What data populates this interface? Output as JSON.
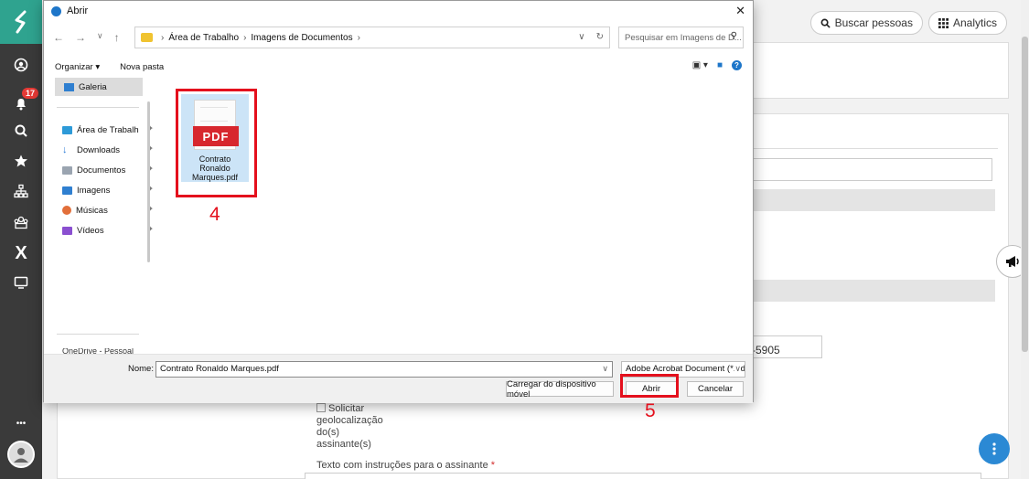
{
  "rail": {
    "logo": "๑",
    "notification_count": "17",
    "icons": [
      "user-circle-icon",
      "bell-icon",
      "search-icon",
      "star-icon",
      "org-chart-icon",
      "team-icon",
      "x-icon",
      "monitor-icon",
      "more-icon"
    ],
    "more_label": "•••"
  },
  "app": {
    "search_people_label": "Buscar pessoas",
    "analytics_label": "Analytics",
    "field_suffix": "-5905",
    "checkbox_label_lines": [
      "Solicitar",
      "geolocalização",
      "do(s)",
      "assinante(s)"
    ],
    "instructions_label": "Texto com instruções para o assinante",
    "required_mark": "*"
  },
  "dialog": {
    "title": "Abrir",
    "close": "✕",
    "breadcrumb": [
      "Área de Trabalho",
      "Imagens de Documentos"
    ],
    "search_placeholder": "Pesquisar em Imagens de D...",
    "organize_label": "Organizar ▾",
    "new_folder_label": "Nova pasta",
    "nav": {
      "gallery": "Galeria",
      "items": [
        {
          "label": "Área de Trabalh",
          "icon": "desktop-icon",
          "color": "#2d9ad8"
        },
        {
          "label": "Downloads",
          "icon": "download-icon",
          "color": "#2b7bd6"
        },
        {
          "label": "Documentos",
          "icon": "document-icon",
          "color": "#9aa4b0"
        },
        {
          "label": "Imagens",
          "icon": "image-icon",
          "color": "#2f7fd0"
        },
        {
          "label": "Músicas",
          "icon": "music-icon",
          "color": "#e26f3a"
        },
        {
          "label": "Vídeos",
          "icon": "video-icon",
          "color": "#8a4fd0"
        }
      ],
      "clipped_item": "OneDrive - Pessoal"
    },
    "file": {
      "badge": "PDF",
      "name": "Contrato Ronaldo Marques.pdf"
    },
    "filename_label": "Nome:",
    "filename_value": "Contrato Ronaldo Marques.pdf",
    "filetype_value": "Adobe Acrobat Document (*.pdf)",
    "upload_button": "Carregar do dispositivo móvel",
    "open_button": "Abrir",
    "cancel_button": "Cancelar"
  },
  "annotations": {
    "step_file": "4",
    "step_open": "5",
    "color": "#e4101d"
  }
}
